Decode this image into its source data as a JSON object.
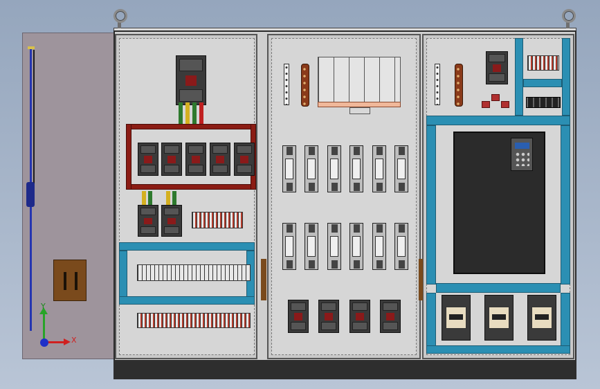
{
  "viewport": {
    "background": "gradient-blue-gray"
  },
  "model": {
    "type": "electrical-control-cabinet",
    "sections": [
      "left-door",
      "distribution-section",
      "fuse-section",
      "vfd-section"
    ],
    "colors": {
      "rail": "#2b8fb3",
      "busbar": "#8b1c14",
      "cabinet": "#cfcfcf",
      "plinth": "#2e2e2e"
    }
  },
  "triad": {
    "x_label": "X",
    "y_label": "Y"
  }
}
